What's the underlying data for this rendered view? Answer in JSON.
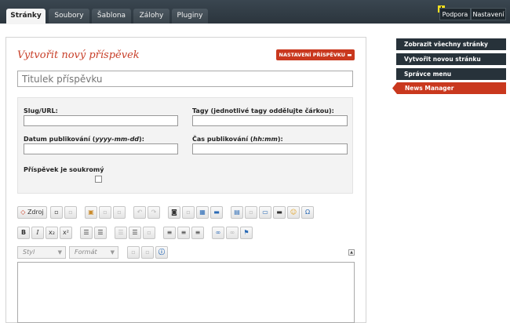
{
  "header": {
    "tabs": [
      {
        "label": "Stránky",
        "active": true
      },
      {
        "label": "Soubory",
        "active": false
      },
      {
        "label": "Šablona",
        "active": false
      },
      {
        "label": "Zálohy",
        "active": false
      },
      {
        "label": "Pluginy",
        "active": false
      }
    ],
    "notification_badge": "!",
    "support_label": "Podpora",
    "settings_label": "Nastavení"
  },
  "form": {
    "title": "Vytvořit nový příspěvek",
    "settings_button": "NASTAVENÍ PŘÍSPĚVKU ▬",
    "title_placeholder": "Titulek příspěvku",
    "slug_label": "Slug/URL:",
    "tags_label": "Tagy (jednotlivé tagy oddělujte čárkou):",
    "date_label_prefix": "Datum publikování (",
    "date_label_format": "yyyy-mm-dd",
    "date_label_suffix": "):",
    "time_label_prefix": "Čas publikování (",
    "time_label_format": "hh:mm",
    "time_label_suffix": "):",
    "private_label": "Příspěvek je soukromý"
  },
  "editor": {
    "source_label": "Zdroj",
    "style_select": "Styl",
    "format_select": "Formát",
    "bold": "B",
    "italic": "I",
    "subscript": "x₂",
    "superscript": "x²",
    "omega": "Ω"
  },
  "sidebar": {
    "items": [
      {
        "label": "Zobrazit všechny stránky",
        "active": false
      },
      {
        "label": "Vytvořit novou stránku",
        "active": false
      },
      {
        "label": "Správce menu",
        "active": false
      },
      {
        "label": "News Manager",
        "active": true
      }
    ]
  },
  "colors": {
    "accent": "#c9381e",
    "header_bg": "#2f3a42",
    "sidebar_bg": "#27323a"
  }
}
